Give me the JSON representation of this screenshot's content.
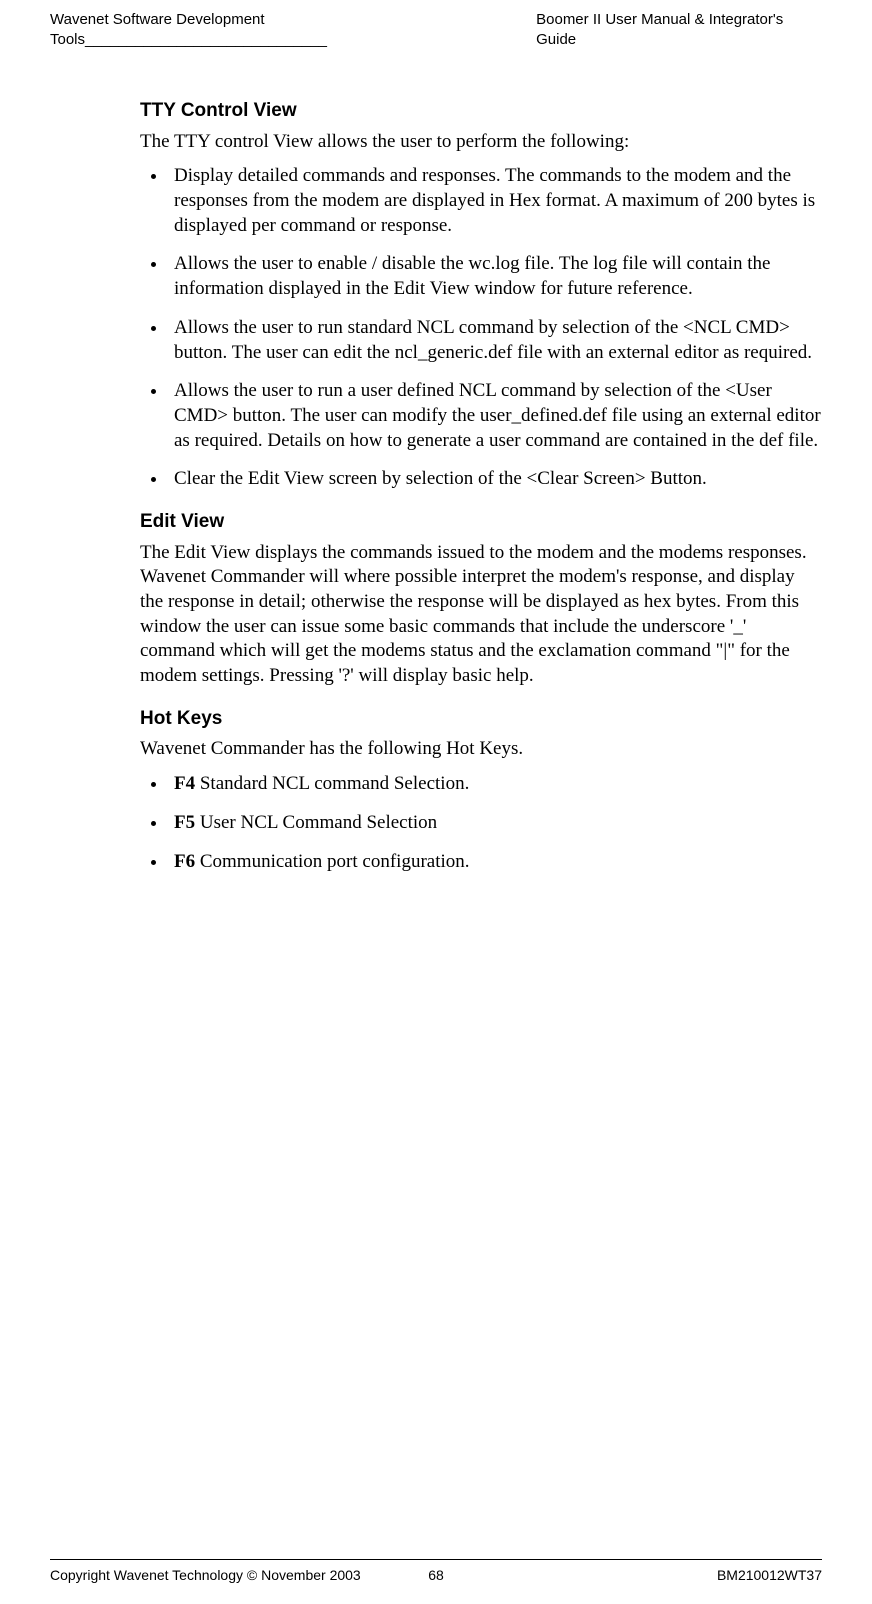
{
  "header": {
    "left": "Wavenet Software Development Tools",
    "right": "Boomer II User Manual & Integrator's Guide"
  },
  "sections": {
    "tty": {
      "title": "TTY Control View",
      "intro": "The TTY control View allows the user to perform the following:",
      "bullets": [
        "Display detailed commands and responses. The commands to the modem and the responses from the modem are displayed in Hex format. A maximum of 200 bytes is displayed per command or response.",
        "Allows the user to enable / disable the wc.log file. The log file will contain the information displayed in the Edit View window for future reference.",
        "Allows the user to run standard NCL command by selection of the <NCL CMD> button. The user can edit the ncl_generic.def file with an external editor as required.",
        "Allows the user to run a user defined NCL command by selection of the <User CMD> button. The user can modify the user_defined.def file using an external editor as required. Details on how to generate a user command are contained in the def file.",
        "Clear the Edit View screen by selection of the <Clear Screen> Button."
      ]
    },
    "edit": {
      "title": "Edit View",
      "body": "The Edit View displays the commands issued to the modem and the modems responses. Wavenet Commander will where possible interpret the modem's response, and display the response in detail; otherwise the response will be displayed as hex bytes. From this window the user can issue some basic commands that include the underscore '_' command which will get the modems status and the exclamation command \"|\" for the modem settings. Pressing '?' will display basic help."
    },
    "hotkeys": {
      "title": "Hot Keys",
      "intro": "Wavenet Commander has the following Hot Keys.",
      "items": [
        {
          "key": "F4",
          "desc": " Standard NCL command Selection."
        },
        {
          "key": "F5",
          "desc": " User NCL Command Selection"
        },
        {
          "key": "F6",
          "desc": " Communication port configuration."
        }
      ]
    }
  },
  "footer": {
    "left": "Copyright Wavenet Technology © November 2003",
    "center": "68",
    "right": "BM210012WT37"
  }
}
